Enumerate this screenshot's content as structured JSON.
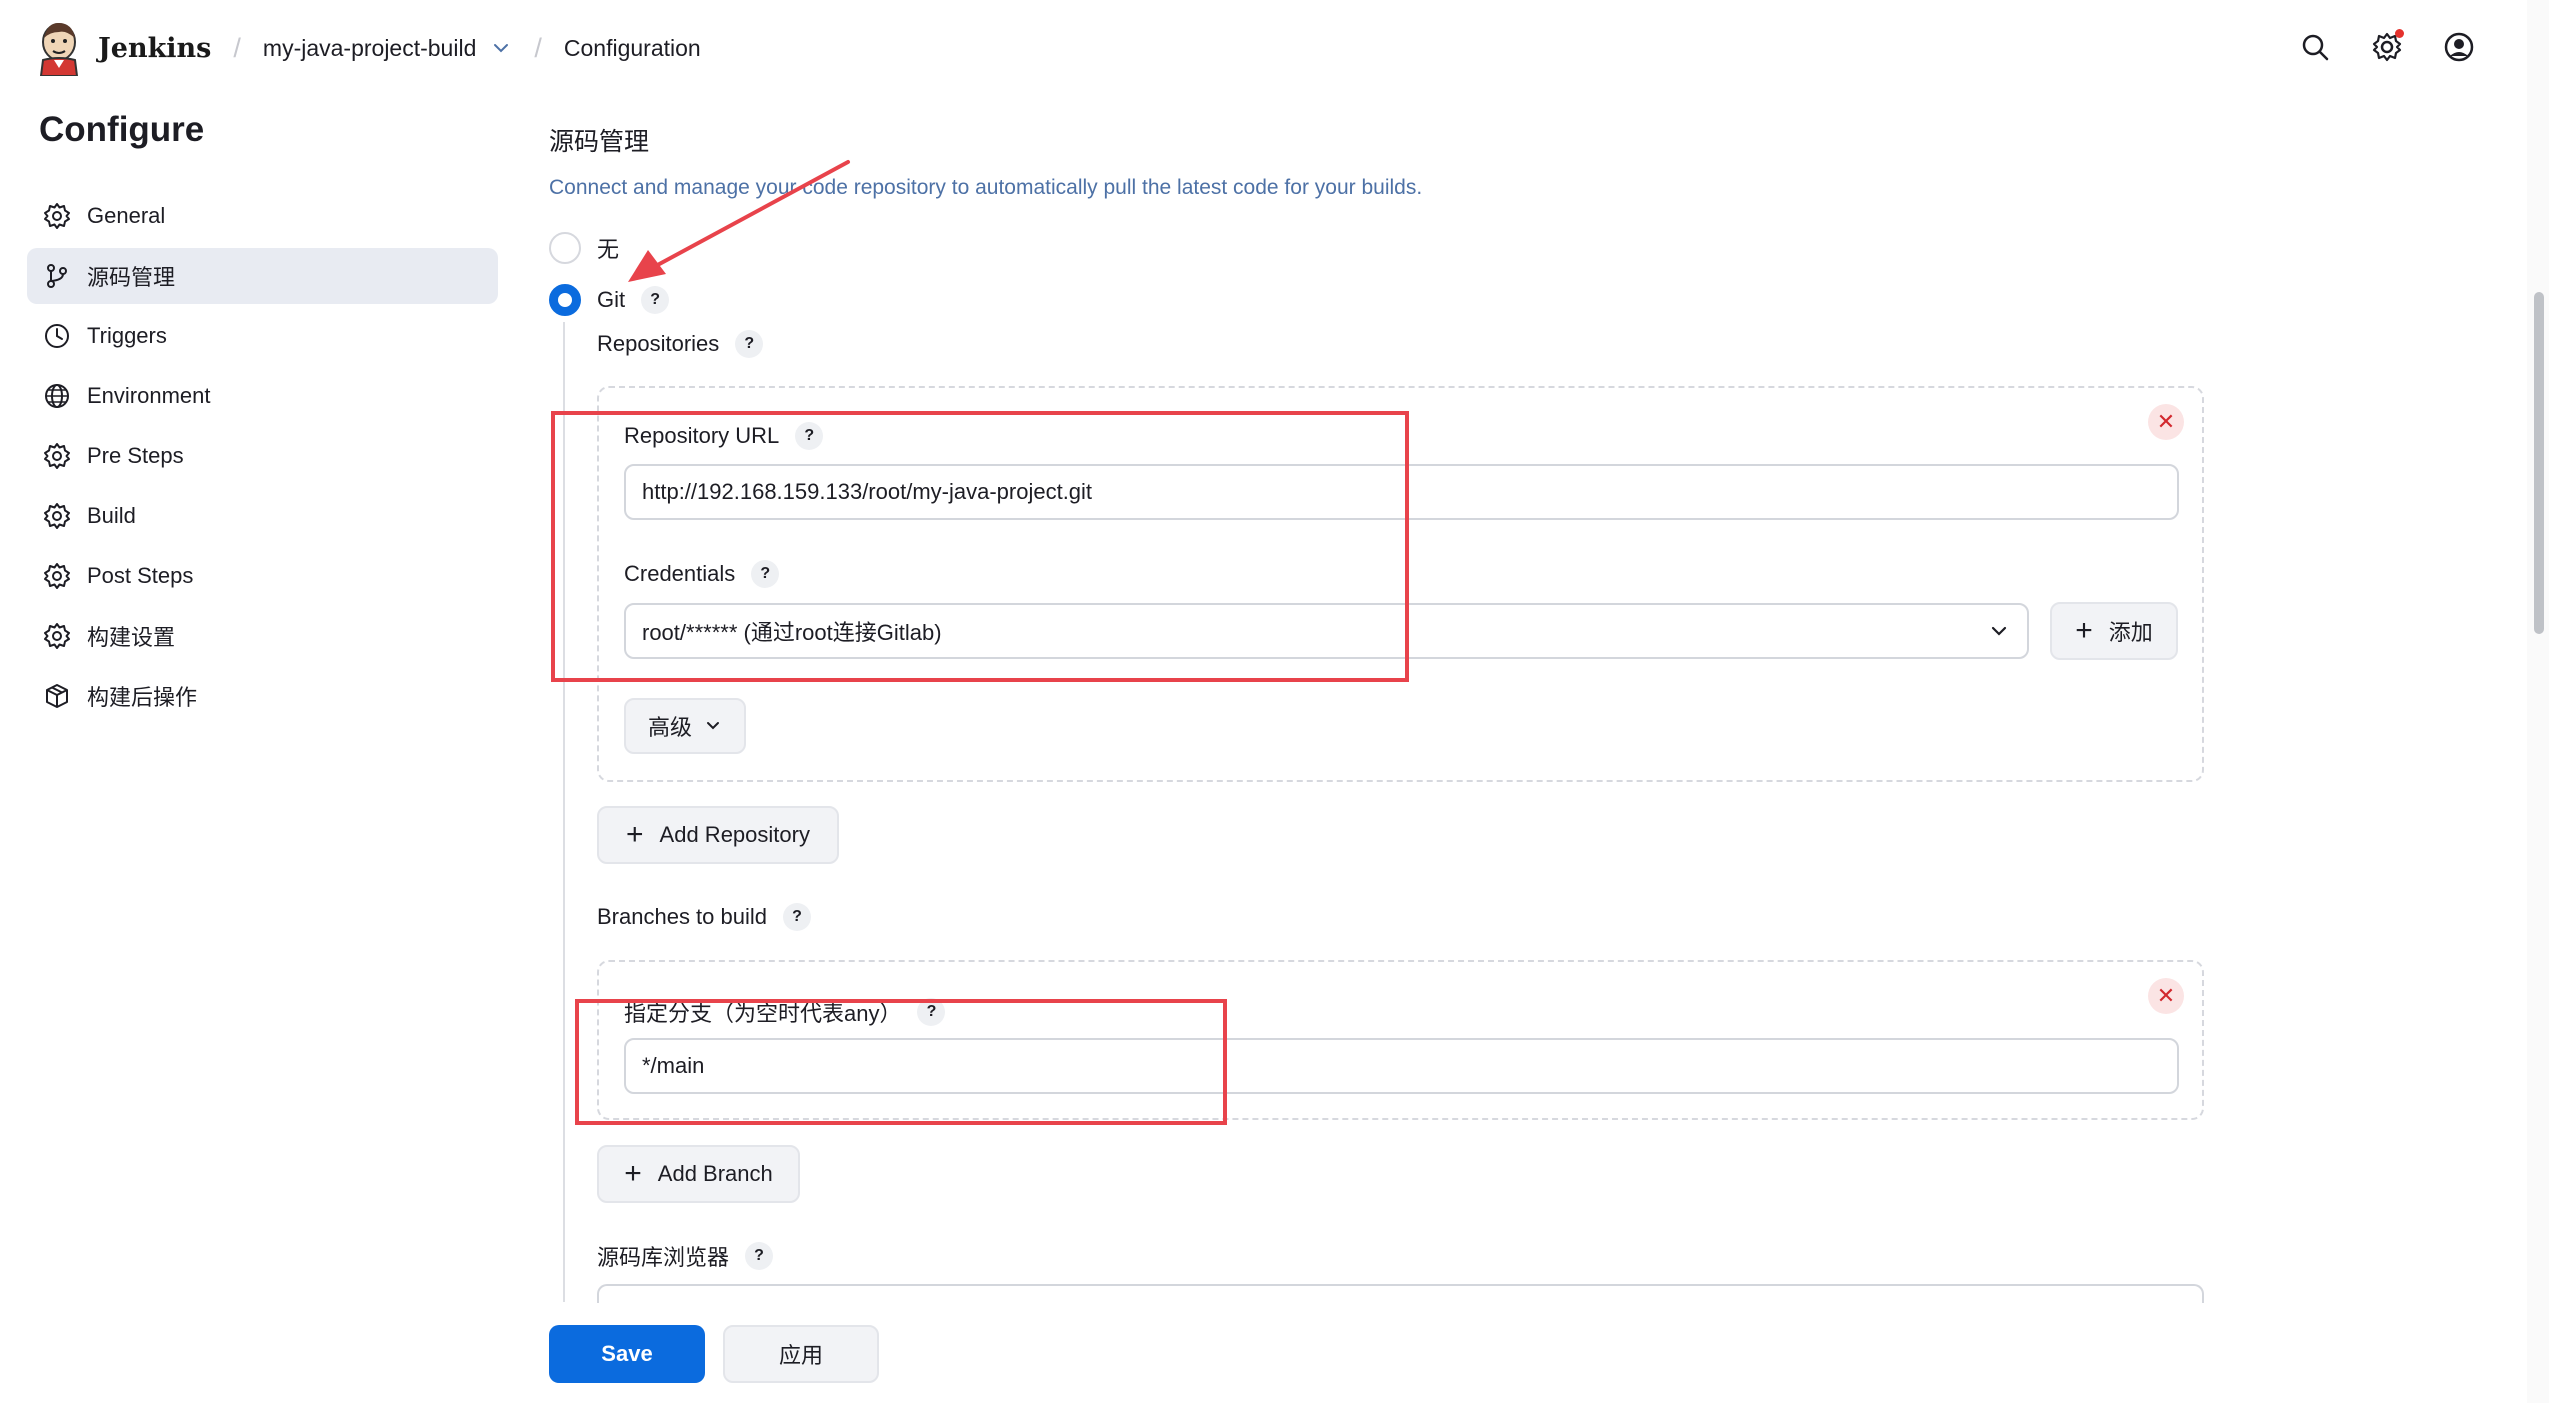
{
  "header": {
    "brand": "Jenkins",
    "breadcrumb_job": "my-java-project-build",
    "breadcrumb_page": "Configuration"
  },
  "sidebar": {
    "title": "Configure",
    "items": [
      {
        "label": "General",
        "icon": "gear-icon"
      },
      {
        "label": "源码管理",
        "icon": "git-branch-icon",
        "active": true
      },
      {
        "label": "Triggers",
        "icon": "clock-icon"
      },
      {
        "label": "Environment",
        "icon": "globe-icon"
      },
      {
        "label": "Pre Steps",
        "icon": "gear-icon"
      },
      {
        "label": "Build",
        "icon": "gear-icon"
      },
      {
        "label": "Post Steps",
        "icon": "gear-icon"
      },
      {
        "label": "构建设置",
        "icon": "gear-icon"
      },
      {
        "label": "构建后操作",
        "icon": "package-icon"
      }
    ]
  },
  "scm": {
    "title": "源码管理",
    "description": "Connect and manage your code repository to automatically pull the latest code for your builds.",
    "option_none": "无",
    "option_git": "Git",
    "selected": "Git",
    "help_glyph": "?",
    "repositories_label": "Repositories",
    "repository_url_label": "Repository URL",
    "repository_url_value": "http://192.168.159.133/root/my-java-project.git",
    "credentials_label": "Credentials",
    "credentials_value": "root/****** (通过root连接Gitlab)",
    "add_credentials_label": "添加",
    "advanced_label": "高级",
    "add_repository_label": "Add Repository",
    "branches_label": "Branches to build",
    "branch_specifier_label": "指定分支（为空时代表any）",
    "branch_specifier_value": "*/main",
    "add_branch_label": "Add Branch",
    "repo_browser_label": "源码库浏览器",
    "delete_glyph": "✕"
  },
  "footer": {
    "save_label": "Save",
    "apply_label": "应用"
  },
  "colors": {
    "accent": "#0b6bde",
    "annotation": "#e8434b",
    "description": "#4d71a6"
  }
}
